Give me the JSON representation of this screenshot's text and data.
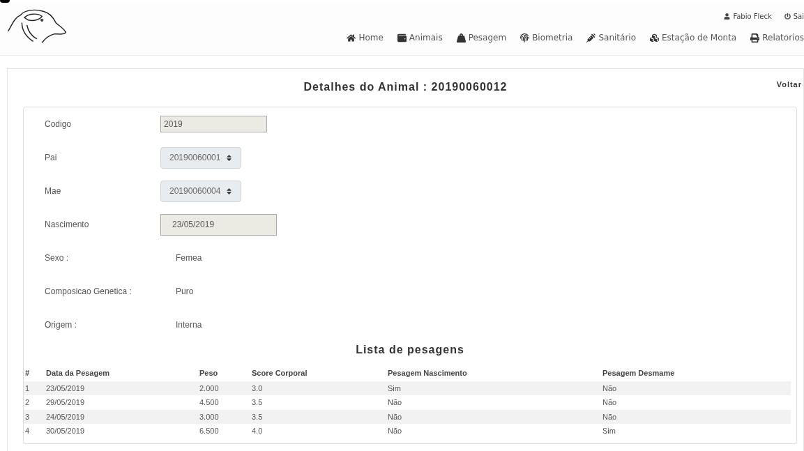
{
  "user_menu": [
    {
      "kind": "user",
      "label": "Fabio Fleck"
    },
    {
      "kind": "power",
      "label": "Sai"
    }
  ],
  "nav": [
    {
      "label": "Home"
    },
    {
      "label": "Animais"
    },
    {
      "label": "Pesagem"
    },
    {
      "label": "Biometria"
    },
    {
      "label": "Sanitário"
    },
    {
      "label": "Estação de Monta"
    },
    {
      "label": "Relatorios"
    }
  ],
  "page_title": "Detalhes do Animal : 20190060012",
  "back_link": "Voltar",
  "fields": [
    {
      "label": "Codigo",
      "kind": "input",
      "value": "2019"
    },
    {
      "label": "Pai",
      "kind": "select",
      "value": "20190060001"
    },
    {
      "label": "Mae",
      "kind": "select",
      "value": "20190060004"
    },
    {
      "label": "Nascimento",
      "kind": "date",
      "value": "23/05/2019"
    },
    {
      "label": "Sexo :",
      "kind": "text",
      "value": "Femea"
    },
    {
      "label": "Composicao Genetica :",
      "kind": "text",
      "value": "Puro"
    },
    {
      "label": "Origem :",
      "kind": "text",
      "value": "Interna"
    }
  ],
  "table_title": "Lista de pesagens",
  "table": {
    "columns": [
      "#",
      "Data da Pesagem",
      "Peso",
      "Score Corporal",
      "Pesagem Nascimento",
      "Pesagem Desmame"
    ],
    "rows": [
      [
        "1",
        "23/05/2019",
        "2.000",
        "3.0",
        "Sim",
        "Não"
      ],
      [
        "2",
        "29/05/2019",
        "4.500",
        "3.5",
        "Não",
        "Não"
      ],
      [
        "3",
        "24/05/2019",
        "3.000",
        "3.5",
        "Não",
        "Não"
      ],
      [
        "4",
        "30/05/2019",
        "6.500",
        "4.0",
        "Não",
        "Sim"
      ]
    ]
  }
}
